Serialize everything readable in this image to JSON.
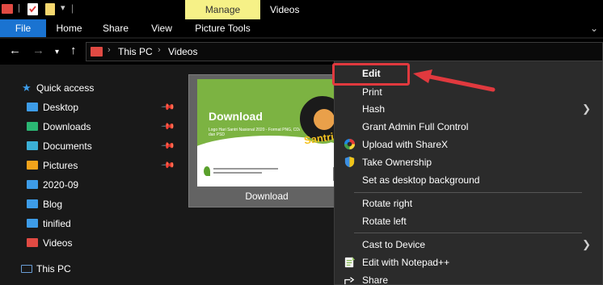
{
  "titlebar": {
    "manage_tab": "Manage",
    "window_title": "Videos"
  },
  "ribbon": {
    "tabs": [
      {
        "label": "File"
      },
      {
        "label": "Home"
      },
      {
        "label": "Share"
      },
      {
        "label": "View"
      },
      {
        "label": "Picture Tools"
      }
    ],
    "collapse_icon": "chevron-down-icon"
  },
  "navigation": {
    "back_icon": "arrow-left-icon",
    "forward_icon": "arrow-right-icon",
    "recent_icon": "chevron-down-icon",
    "up_icon": "arrow-up-icon",
    "breadcrumb": [
      "This PC",
      "Videos"
    ]
  },
  "sidebar": {
    "quick_access": "Quick access",
    "items": [
      {
        "label": "Desktop",
        "color": "#3d9ce8",
        "pinned": true
      },
      {
        "label": "Downloads",
        "color": "#2bb673",
        "pinned": true
      },
      {
        "label": "Documents",
        "color": "#3bb0d6",
        "pinned": true
      },
      {
        "label": "Pictures",
        "color": "#f2a31b",
        "pinned": true
      },
      {
        "label": "2020-09",
        "color": "#3d9ce8",
        "pinned": false
      },
      {
        "label": "Blog",
        "color": "#3d9ce8",
        "pinned": false
      },
      {
        "label": "tinified",
        "color": "#3d9ce8",
        "pinned": false
      },
      {
        "label": "Videos",
        "color": "#e04a43",
        "pinned": false
      }
    ],
    "this_pc": "This PC"
  },
  "content": {
    "file": {
      "caption": "Download",
      "thumbnail": {
        "title": "Download",
        "subtitle": "Logo Hari Santri Nasional 2020 - Format PNG, CDR dan PSD",
        "badge_text": "Santri"
      }
    }
  },
  "context_menu": {
    "items": [
      {
        "label": "Edit",
        "bold": true,
        "highlighted": true
      },
      {
        "label": "Print"
      },
      {
        "label": "Hash",
        "submenu": true
      },
      {
        "label": "Grant Admin Full Control"
      },
      {
        "label": "Upload with ShareX",
        "icon": "sharex-icon"
      },
      {
        "label": "Take Ownership",
        "icon": "shield-icon"
      },
      {
        "label": "Set as desktop background"
      },
      {
        "label": "Rotate right"
      },
      {
        "label": "Rotate left"
      },
      {
        "label": "Cast to Device",
        "submenu": true
      },
      {
        "label": "Edit with Notepad++",
        "icon": "notepad-plus-plus-icon"
      },
      {
        "label": "Share",
        "icon": "share-icon"
      }
    ]
  },
  "colors": {
    "accent_blue": "#1a73d1",
    "manage_yellow": "#f6f187",
    "annotation_red": "#e0393e"
  }
}
